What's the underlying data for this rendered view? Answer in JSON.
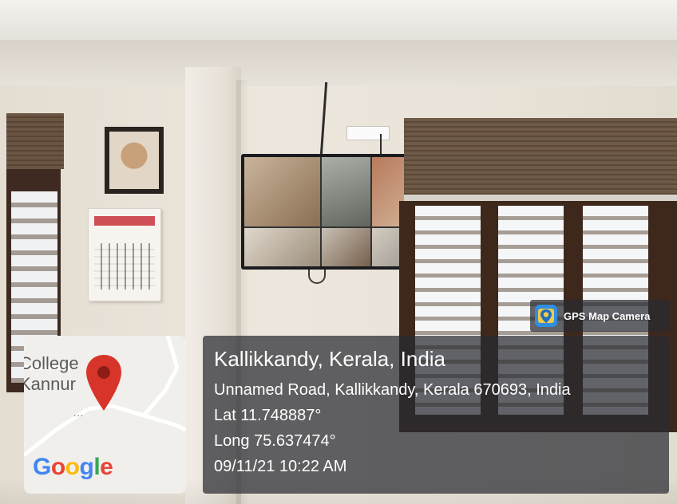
{
  "gps_badge": {
    "label": "GPS Map Camera",
    "icon": "map-camera-icon",
    "icon_color": "#2f8fe0"
  },
  "map": {
    "place_label": "College\nKannur",
    "dots": "...",
    "logo_text": "Google",
    "pin_color": "#d8352a"
  },
  "location": {
    "place": "Kallikkandy, Kerala, India",
    "address": "Unnamed Road, Kallikkandy, Kerala 670693, India",
    "lat": "Lat 11.748887°",
    "long": "Long 75.637474°",
    "datetime": "09/11/21 10:22 AM"
  },
  "overlay_color": "#282a30"
}
